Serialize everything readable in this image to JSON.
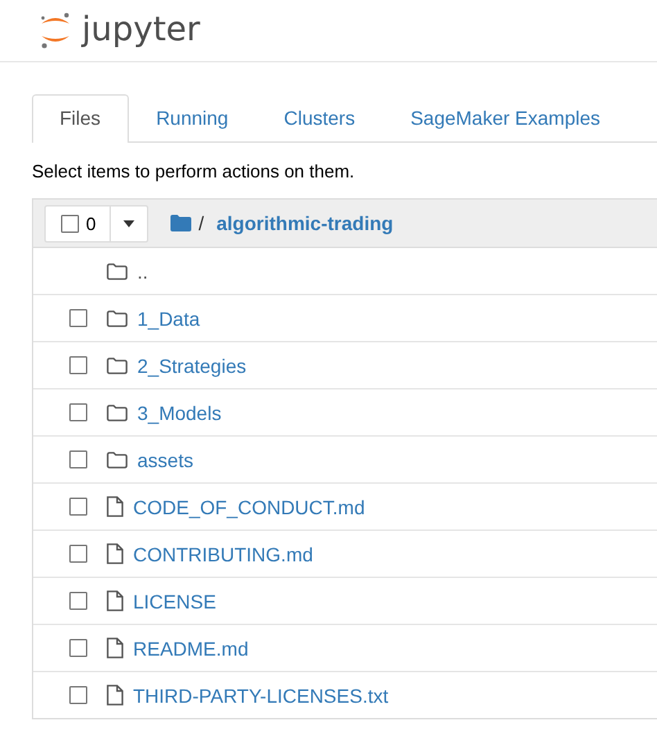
{
  "header": {
    "logo_text": "jupyter"
  },
  "tabs": [
    {
      "label": "Files",
      "selected": true
    },
    {
      "label": "Running",
      "selected": false
    },
    {
      "label": "Clusters",
      "selected": false
    },
    {
      "label": "SageMaker Examples",
      "selected": false
    }
  ],
  "instructions": "Select items to perform actions on them.",
  "list_header": {
    "select_all_checked": false,
    "selected_count": "0",
    "path_separator": "/",
    "folder": "algorithmic-trading"
  },
  "items": [
    {
      "kind": "parent",
      "name": ".."
    },
    {
      "kind": "folder",
      "name": "1_Data",
      "checked": false
    },
    {
      "kind": "folder",
      "name": "2_Strategies",
      "checked": false
    },
    {
      "kind": "folder",
      "name": "3_Models",
      "checked": false
    },
    {
      "kind": "folder",
      "name": "assets",
      "checked": false
    },
    {
      "kind": "file",
      "name": "CODE_OF_CONDUCT.md",
      "checked": false
    },
    {
      "kind": "file",
      "name": "CONTRIBUTING.md",
      "checked": false
    },
    {
      "kind": "file",
      "name": "LICENSE",
      "checked": false
    },
    {
      "kind": "file",
      "name": "README.md",
      "checked": false
    },
    {
      "kind": "file",
      "name": "THIRD-PARTY-LICENSES.txt",
      "checked": false
    }
  ]
}
